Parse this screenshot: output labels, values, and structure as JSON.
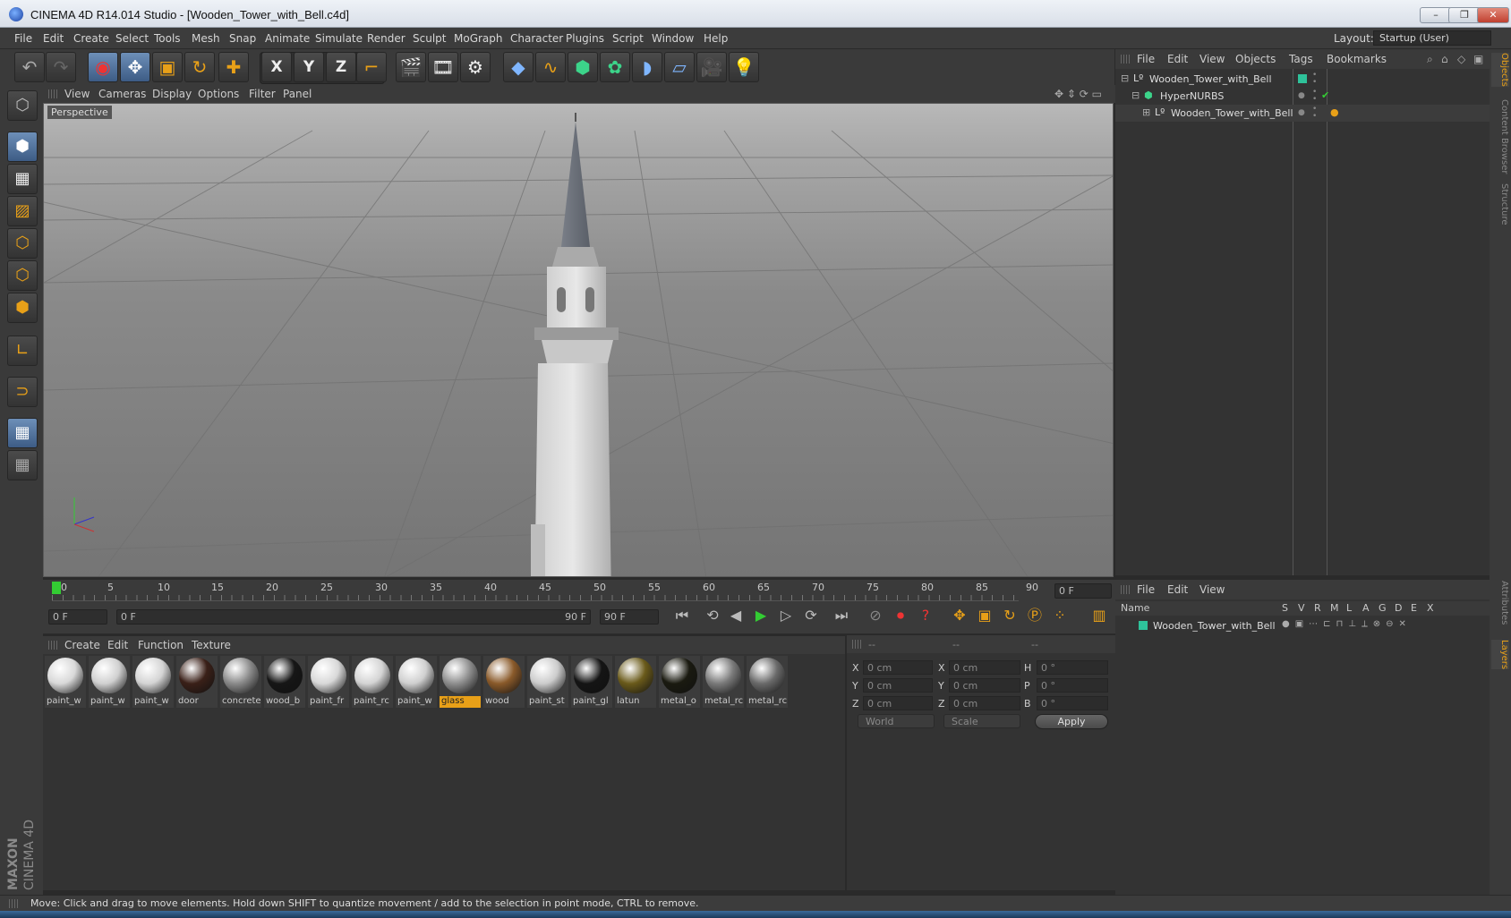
{
  "window": {
    "title": "CINEMA 4D R14.014 Studio - [Wooden_Tower_with_Bell.c4d]",
    "minimize": "–",
    "restore": "❐",
    "close": "✕"
  },
  "menubar": {
    "items": [
      "File",
      "Edit",
      "Create",
      "Select",
      "Tools",
      "Mesh",
      "Snap",
      "Animate",
      "Simulate",
      "Render",
      "Sculpt",
      "MoGraph",
      "Character",
      "Plugins",
      "Script",
      "Window",
      "Help"
    ],
    "layout_label": "Layout:",
    "layout_value": "Startup (User)"
  },
  "toolbar": {
    "icons": [
      "undo-icon",
      "redo-icon",
      "live-select-icon",
      "move-icon",
      "scale-icon",
      "rotate-icon",
      "world-add-icon",
      "x-axis-icon",
      "y-axis-icon",
      "z-axis-icon",
      "coordinate-system-icon",
      "render-view-icon",
      "render-picture-viewer-icon",
      "render-settings-icon",
      "cube-icon",
      "spline-icon",
      "nurbs-icon",
      "array-icon",
      "deformer-icon",
      "floor-icon",
      "camera-icon",
      "light-icon"
    ],
    "x": "X",
    "y": "Y",
    "z": "Z"
  },
  "viewport": {
    "menu": [
      "View",
      "Cameras",
      "Display",
      "Options",
      "Filter",
      "Panel"
    ],
    "label": "Perspective"
  },
  "timeline": {
    "ticks": [
      "0",
      "5",
      "10",
      "15",
      "20",
      "25",
      "30",
      "35",
      "40",
      "45",
      "50",
      "55",
      "60",
      "65",
      "70",
      "75",
      "80",
      "85",
      "90"
    ],
    "current_frame": "0 F"
  },
  "transport": {
    "start": "0 F",
    "range_start": "0 F",
    "range_end": "90 F",
    "end": "90 F"
  },
  "materials": {
    "menu": [
      "Create",
      "Edit",
      "Function",
      "Texture"
    ],
    "items": [
      {
        "name": "paint_w",
        "color": "#d8d8d8"
      },
      {
        "name": "paint_w",
        "color": "#d0d0d0"
      },
      {
        "name": "paint_w",
        "color": "#d4d4d4"
      },
      {
        "name": "door",
        "color": "#3a2018"
      },
      {
        "name": "concrete",
        "color": "#8a8a8a"
      },
      {
        "name": "wood_b",
        "color": "#161616"
      },
      {
        "name": "paint_fr",
        "color": "#d8d8d8"
      },
      {
        "name": "paint_rc",
        "color": "#d4d4d4"
      },
      {
        "name": "paint_w",
        "color": "#cfcfcf"
      },
      {
        "name": "glass",
        "color": "#8e8e8e"
      },
      {
        "name": "wood",
        "color": "#8a5a2a"
      },
      {
        "name": "paint_st",
        "color": "#cccccc"
      },
      {
        "name": "paint_gl",
        "color": "#141414"
      },
      {
        "name": "latun",
        "color": "#6a5a1a"
      },
      {
        "name": "metal_o",
        "color": "#1a1a10"
      },
      {
        "name": "metal_rc",
        "color": "#7a7a7a"
      },
      {
        "name": "metal_rc",
        "color": "#6a6a6a"
      }
    ],
    "selected_index": 9
  },
  "attributes": {
    "headers": [
      "--",
      "--",
      "--"
    ],
    "rows": [
      {
        "a": "X",
        "av": "0 cm",
        "b": "X",
        "bv": "0 cm",
        "c": "H",
        "cv": "0 °"
      },
      {
        "a": "Y",
        "av": "0 cm",
        "b": "Y",
        "bv": "0 cm",
        "c": "P",
        "cv": "0 °"
      },
      {
        "a": "Z",
        "av": "0 cm",
        "b": "Z",
        "bv": "0 cm",
        "c": "B",
        "cv": "0 °"
      }
    ],
    "coord_mode": "World",
    "size_mode": "Scale",
    "apply": "Apply"
  },
  "objects": {
    "menu": [
      "File",
      "Edit",
      "View",
      "Objects",
      "Tags",
      "Bookmarks"
    ],
    "tree": [
      {
        "name": "Wooden_Tower_with_Bell",
        "indent": 0
      },
      {
        "name": "HyperNURBS",
        "indent": 1
      },
      {
        "name": "Wooden_Tower_with_Bell",
        "indent": 2
      }
    ]
  },
  "layers": {
    "menu": [
      "File",
      "Edit",
      "View"
    ],
    "columns": [
      "Name",
      "S",
      "V",
      "R",
      "M",
      "L",
      "A",
      "G",
      "D",
      "E",
      "X"
    ],
    "rows": [
      {
        "name": "Wooden_Tower_with_Bell",
        "color": "#2ec29a"
      }
    ]
  },
  "right_tabs": [
    "Objects",
    "Content Browser",
    "Structure",
    "Attributes",
    "Layers"
  ],
  "status": "Move: Click and drag to move elements. Hold down SHIFT to quantize movement / add to the selection in point mode, CTRL to remove.",
  "brand": {
    "line1": "MAXON",
    "line2": "CINEMA 4D"
  },
  "colors": {
    "accent": "#e8a018",
    "selection": "#4a6d99",
    "layer_green": "#2ec29a"
  }
}
